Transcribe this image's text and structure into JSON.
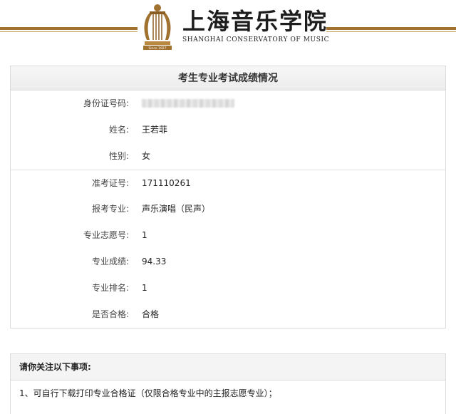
{
  "header": {
    "school_name_cn": "上海音乐学院",
    "school_name_en": "SHANGHAI CONSERVATORY OF MUSIC",
    "since": "Since 1927",
    "brand_color": "#a0712f"
  },
  "results": {
    "title": "考生专业考试成绩情况",
    "rows": [
      {
        "label": "身份证号码:",
        "value": ""
      },
      {
        "label": "姓名:",
        "value": "王若菲"
      },
      {
        "label": "性别:",
        "value": "女"
      },
      {
        "label": "准考证号:",
        "value": "171110261"
      },
      {
        "label": "报考专业:",
        "value": "声乐演唱（民声）"
      },
      {
        "label": "专业志愿号:",
        "value": "1"
      },
      {
        "label": "专业成绩:",
        "value": "94.33"
      },
      {
        "label": "专业排名:",
        "value": "1"
      },
      {
        "label": "是否合格:",
        "value": "合格"
      }
    ]
  },
  "notice": {
    "title": "请你关注以下事项:",
    "items": [
      "1、可自行下载打印专业合格证（仅限合格专业中的主报志愿专业）；"
    ]
  }
}
